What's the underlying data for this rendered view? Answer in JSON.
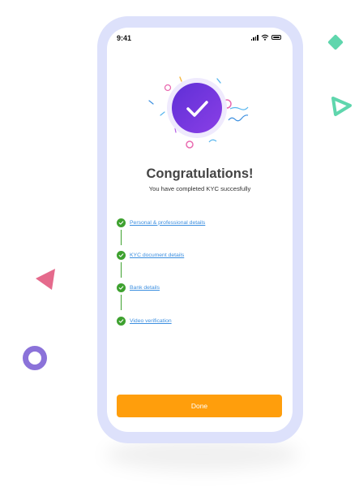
{
  "status_bar": {
    "time": "9:41"
  },
  "success": {
    "title": "Congratulations!",
    "subtitle": "You have completed KYC succesfully"
  },
  "steps": [
    {
      "label": "Personal & professional details",
      "status": "completed"
    },
    {
      "label": "KYC document details",
      "status": "completed"
    },
    {
      "label": "Bank details",
      "status": "completed"
    },
    {
      "label": "Video verification",
      "status": "completed"
    }
  ],
  "actions": {
    "done_label": "Done"
  },
  "colors": {
    "accent": "#ff9e0c",
    "success": "#3ea12f",
    "link": "#3c8fe0",
    "hero": "#6a35de",
    "frame": "#dde1fb"
  },
  "icons": {
    "hero": "check-icon",
    "step": "check-circle-icon",
    "signal": "cellular-signal-icon",
    "wifi": "wifi-icon",
    "battery": "battery-icon"
  }
}
